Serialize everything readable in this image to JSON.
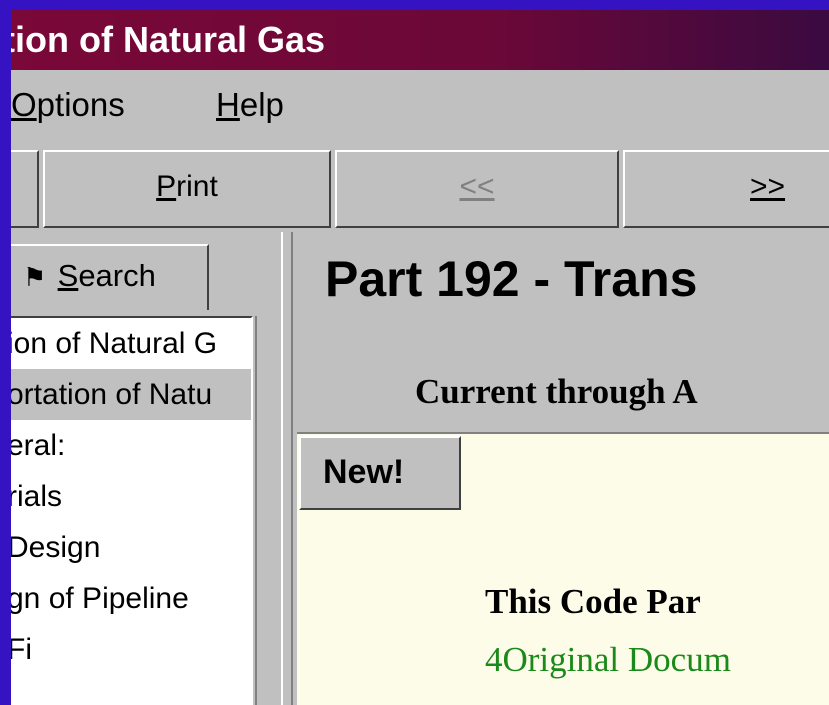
{
  "window": {
    "title": "tion of Natural Gas"
  },
  "menubar": {
    "options_u": "O",
    "options_rest": "ptions",
    "help_u": "H",
    "help_rest": "elp"
  },
  "toolbar": {
    "print_u": "P",
    "print_rest": "rint",
    "back_label": "<<",
    "forward_label": ">>"
  },
  "sidebar": {
    "search_tab_u": "S",
    "search_tab_rest": "earch",
    "items": [
      {
        "label": "ion of Natural G"
      },
      {
        "label": "ortation of Natu"
      },
      {
        "label": "eral:"
      },
      {
        "label": "rials"
      },
      {
        "label": "Design"
      },
      {
        "label": "gn of Pipeline"
      },
      {
        "label": "Fi"
      }
    ]
  },
  "content": {
    "heading": "Part 192 - Trans",
    "subheading": "Current through A",
    "new_button": "New!",
    "doc_title": "This Code Par",
    "doc_link": "4Original Docum"
  },
  "colors": {
    "title_bg": "#7a0838",
    "link": "#1a8a1a",
    "doc_bg": "#fdfce8",
    "frame": "#3512c2"
  }
}
